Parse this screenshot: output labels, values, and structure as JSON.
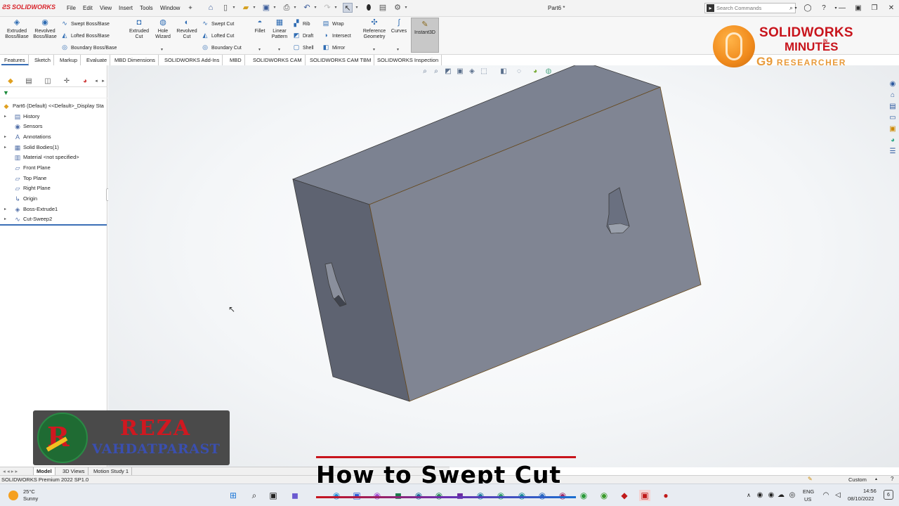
{
  "app": {
    "logo": "SOLIDWORKS",
    "document_title": "Part6 *"
  },
  "menu": [
    "File",
    "Edit",
    "View",
    "Insert",
    "Tools",
    "Window"
  ],
  "search": {
    "placeholder": "Search Commands"
  },
  "ribbon": {
    "extruded_boss": "Extruded Boss/Base",
    "revolved_boss": "Revolved Boss/Base",
    "swept_boss": "Swept Boss/Base",
    "lofted_boss": "Lofted Boss/Base",
    "boundary_boss": "Boundary Boss/Base",
    "extruded_cut": "Extruded Cut",
    "hole_wizard": "Hole Wizard",
    "revolved_cut": "Revolved Cut",
    "swept_cut": "Swept Cut",
    "lofted_cut": "Lofted Cut",
    "boundary_cut": "Boundary Cut",
    "fillet": "Fillet",
    "linear_pattern": "Linear Pattern",
    "rib": "Rib",
    "draft": "Draft",
    "shell": "Shell",
    "wrap": "Wrap",
    "intersect": "Intersect",
    "mirror": "Mirror",
    "reference_geometry": "Reference Geometry",
    "curves": "Curves",
    "instant3d": "Instant3D"
  },
  "cm_tabs": [
    "Features",
    "Sketch",
    "Markup",
    "Evaluate",
    "MBD Dimensions",
    "SOLIDWORKS Add-Ins",
    "MBD",
    "SOLIDWORKS CAM",
    "SOLIDWORKS CAM TBM",
    "SOLIDWORKS Inspection"
  ],
  "tree": {
    "root": "Part6 (Default) <<Default>_Display Sta",
    "items": [
      "History",
      "Sensors",
      "Annotations",
      "Solid Bodies(1)",
      "Material <not specified>",
      "Front Plane",
      "Top Plane",
      "Right Plane",
      "Origin",
      "Boss-Extrude1",
      "Cut-Sweep2"
    ]
  },
  "watermark": {
    "line1": "SOLIDWORKS",
    "line_in": "IN",
    "line2": "MINUTES",
    "line3_a": "G9",
    "line3_b": "RESEARCHER"
  },
  "presenter": {
    "first": "REZA",
    "last": "VAHDATPARAST"
  },
  "model_tabs": [
    "Model",
    "3D Views",
    "Motion Study 1"
  ],
  "status": {
    "left": "SOLIDWORKS Premium 2022 SP1.0",
    "units": "Custom"
  },
  "caption": "How to  Swept Cut",
  "taskbar": {
    "temp": "25°C",
    "weather": "Sunny",
    "lang1": "ENG",
    "lang2": "US",
    "time": "14:56",
    "date": "08/10/2022",
    "notifications": "6"
  },
  "colors": {
    "part_top": "#7c8291",
    "part_front": "#808593",
    "part_side": "#5e6371",
    "accent_red": "#c8141c",
    "selection_blue": "#3a6fb6"
  }
}
